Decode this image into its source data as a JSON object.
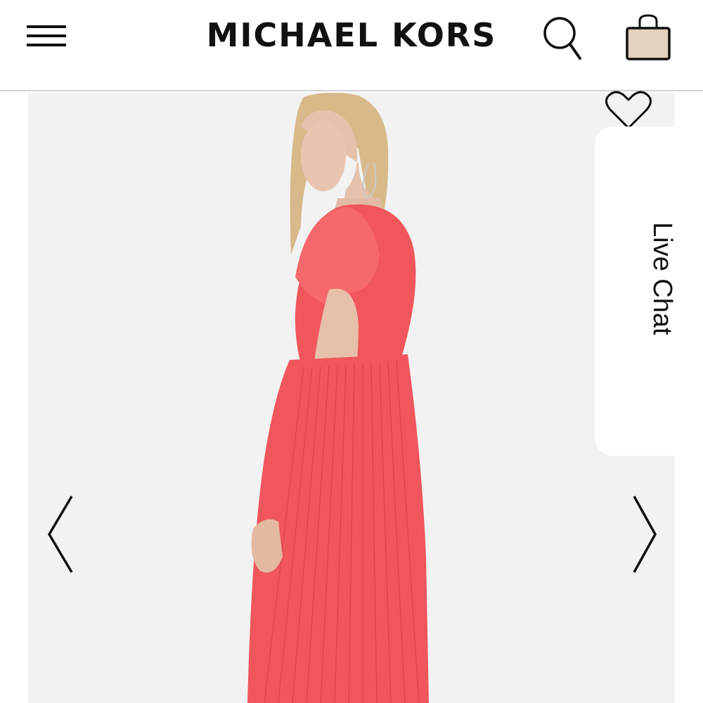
{
  "header": {
    "brand": "MICHAEL KORS",
    "menu_icon": "hamburger-menu-icon",
    "search_icon": "search-icon",
    "bag_icon": "shopping-bag-icon",
    "bag_fill_color": "#e3d2bd"
  },
  "product_image": {
    "background_color": "#f2f2f2",
    "dress_color": "#f0565c"
  },
  "favorite": {
    "icon": "heart-icon"
  },
  "live_chat": {
    "label": "Live Chat"
  },
  "carousel": {
    "prev_icon": "chevron-left-icon",
    "next_icon": "chevron-right-icon"
  }
}
